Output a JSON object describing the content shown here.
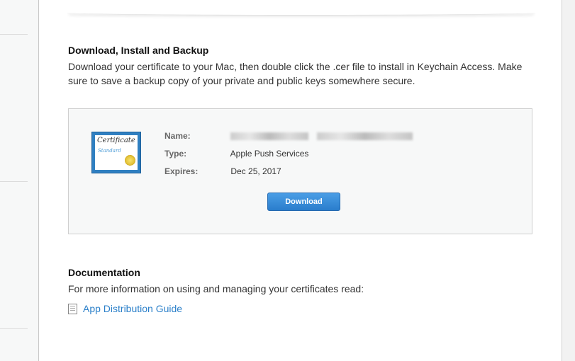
{
  "download_section": {
    "title": "Download, Install and Backup",
    "description": "Download your certificate to your Mac, then double click the .cer file to install in Keychain Access. Make sure to save a backup copy of your private and public keys somewhere secure."
  },
  "certificate": {
    "icon_text_1": "Certificate",
    "icon_text_2": "Standard",
    "name_label": "Name:",
    "type_label": "Type:",
    "type_value": "Apple Push Services",
    "expires_label": "Expires:",
    "expires_value": "Dec 25, 2017",
    "download_label": "Download"
  },
  "documentation": {
    "title": "Documentation",
    "description": "For more information on using and managing your certificates read:",
    "link_label": "App Distribution Guide"
  }
}
